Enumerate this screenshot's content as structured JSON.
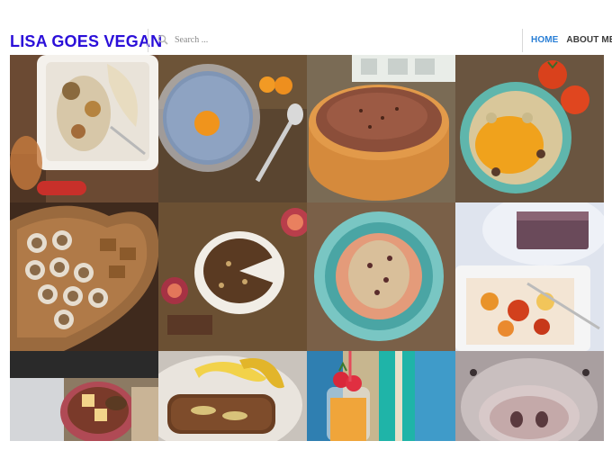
{
  "header": {
    "site_title": "LISA GOES VEGAN",
    "search_placeholder": "Search ...",
    "nav": [
      {
        "label": "HOME",
        "active": true
      },
      {
        "label": "ABOUT ME",
        "active": false
      }
    ]
  },
  "colors": {
    "title": "#2b0fd9",
    "nav_active": "#2a7fd6",
    "nav_default": "#3a3a3a"
  },
  "gallery": [
    {
      "name": "porridge-with-pear-photo"
    },
    {
      "name": "chia-pudding-photo"
    },
    {
      "name": "chocolate-tart-photo"
    },
    {
      "name": "turquoise-bowl-porridge-photo"
    },
    {
      "name": "heart-plate-bites-photo"
    },
    {
      "name": "nut-cake-with-figs-photo"
    },
    {
      "name": "teal-bowl-porridge-photo"
    },
    {
      "name": "cake-and-fruit-salad-photo"
    },
    {
      "name": "stuffed-tomatoes-photo"
    },
    {
      "name": "banana-bread-photo"
    },
    {
      "name": "strawberry-drink-photo"
    },
    {
      "name": "pig-snout-photo"
    }
  ]
}
